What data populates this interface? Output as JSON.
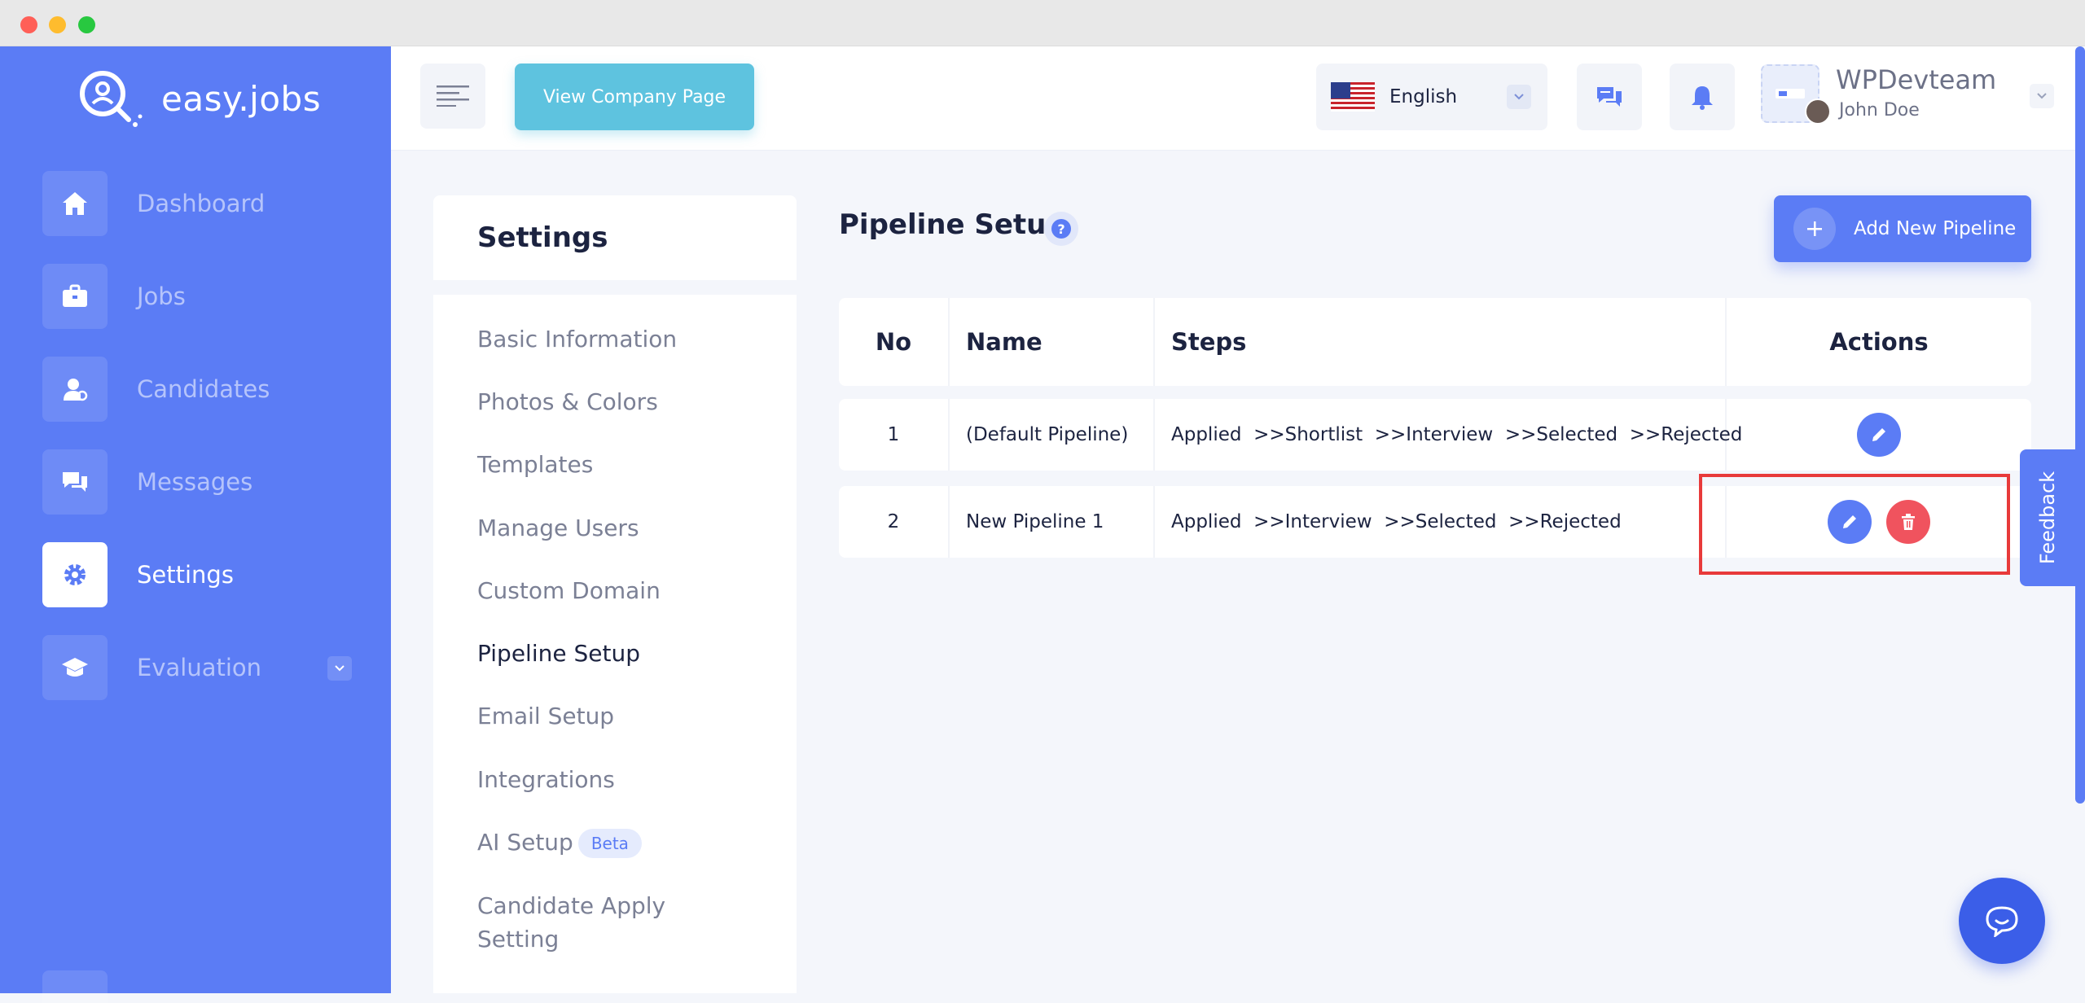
{
  "brand": {
    "name": "easy.jobs"
  },
  "sidebar": {
    "items": [
      {
        "label": "Dashboard",
        "icon": "home-icon"
      },
      {
        "label": "Jobs",
        "icon": "briefcase-icon"
      },
      {
        "label": "Candidates",
        "icon": "user-icon"
      },
      {
        "label": "Messages",
        "icon": "chat-icon"
      },
      {
        "label": "Settings",
        "icon": "gear-icon",
        "active": true
      },
      {
        "label": "Evaluation",
        "icon": "graduation-cap-icon",
        "has_dropdown": true
      }
    ]
  },
  "topbar": {
    "view_company_label": "View Company Page",
    "language": "English",
    "company_name": "WPDevteam",
    "user_name": "John Doe"
  },
  "settings": {
    "title": "Settings",
    "items": [
      "Basic Information",
      "Photos & Colors",
      "Templates",
      "Manage Users",
      "Custom Domain",
      "Pipeline Setup",
      "Email Setup",
      "Integrations",
      "AI Setup",
      "Candidate Apply Setting"
    ],
    "active": "Pipeline Setup",
    "beta_label": "Beta"
  },
  "main": {
    "title": "Pipeline Setup",
    "add_button_label": "Add New Pipeline",
    "table": {
      "headers": [
        "No",
        "Name",
        "Steps",
        "Actions"
      ],
      "rows": [
        {
          "no": "1",
          "name": "(Default Pipeline)",
          "steps": "Applied  >>Shortlist  >>Interview  >>Selected  >>Rejected",
          "deletable": false
        },
        {
          "no": "2",
          "name": "New Pipeline 1",
          "steps": "Applied  >>Interview  >>Selected  >>Rejected",
          "deletable": true
        }
      ]
    }
  },
  "feedback_label": "Feedback",
  "colors": {
    "primary": "#5b7cf5",
    "company_button": "#5ec3df",
    "delete": "#f0535e",
    "highlight": "#e83a3a"
  }
}
